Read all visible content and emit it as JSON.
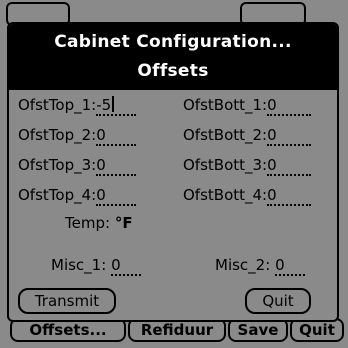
{
  "dialog": {
    "title": "Cabinet Configuration...",
    "subtitle": "Offsets"
  },
  "fields": [
    {
      "label": "OfstTop_1:",
      "value": "-5"
    },
    {
      "label": "OfstBott_1:",
      "value": "0"
    },
    {
      "label": "OfstTop_2:",
      "value": "0"
    },
    {
      "label": "OfstBott_2:",
      "value": "0"
    },
    {
      "label": "OfstTop_3:",
      "value": "0"
    },
    {
      "label": "OfstBott_3:",
      "value": "0"
    },
    {
      "label": "OfstTop_4:",
      "value": "0"
    },
    {
      "label": "OfstBott_4:",
      "value": "0"
    }
  ],
  "temp": {
    "label": "Temp:",
    "unit": "°F"
  },
  "misc": [
    {
      "label": "Misc_1:",
      "value": "0"
    },
    {
      "label": "Misc_2:",
      "value": "0"
    }
  ],
  "buttons": {
    "transmit": "Transmit",
    "quit": "Quit"
  },
  "background_app": {
    "buttons": [
      "Offsets...",
      "Refiduur",
      "Save",
      "Quit"
    ]
  },
  "colors": {
    "background": "#8a8a8a",
    "titlebar": "#000000",
    "title_text": "#ffffff"
  }
}
